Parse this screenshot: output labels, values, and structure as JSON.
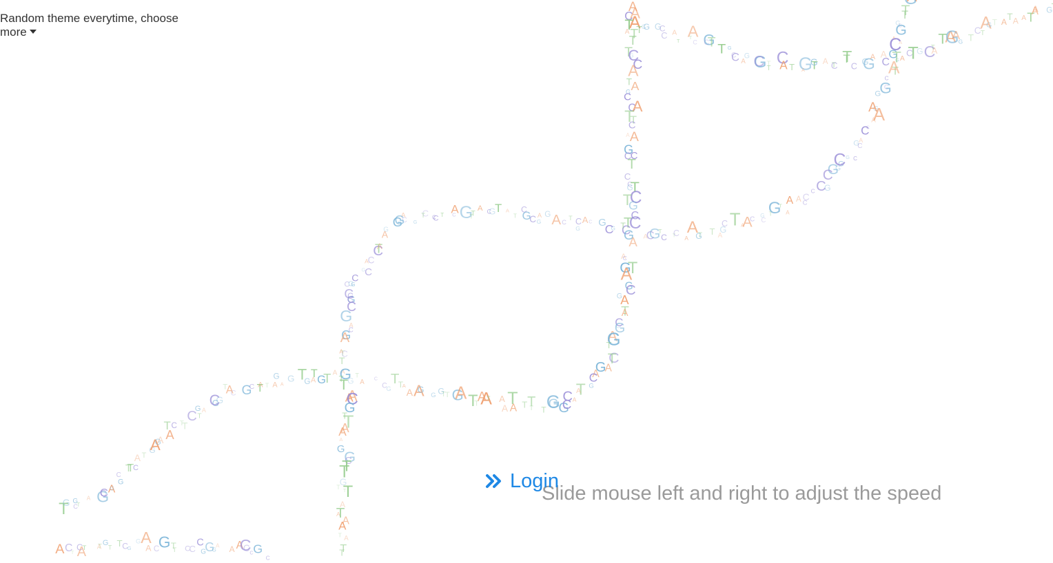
{
  "theme_menu": {
    "line1": "Random theme everytime, choose",
    "line2": "more",
    "caret_icon": "caret-down-icon"
  },
  "login": {
    "label": "Login",
    "icon": "double-chevron-right-icon",
    "color": "#1e88e5"
  },
  "hint": {
    "text": "Slide mouse left and right to adjust the speed",
    "color": "#9a9a9a"
  },
  "background": {
    "letters": [
      "A",
      "C",
      "G",
      "T"
    ],
    "colors": {
      "A": "#f0a070",
      "C": "#9b8fd8",
      "G": "#7ab4d8",
      "T": "#94cc8c"
    }
  }
}
